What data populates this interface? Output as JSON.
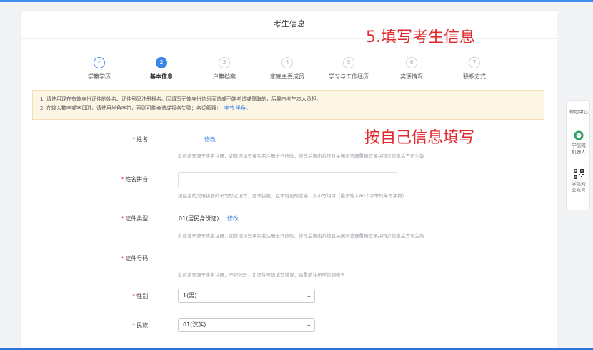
{
  "page": {
    "title": "考生信息"
  },
  "annotations": {
    "step_note": "5.填写考生信息",
    "fill_note": "按自己信息填写"
  },
  "steps": [
    {
      "num": "✓",
      "label": "学籍学历",
      "state": "done"
    },
    {
      "num": "2",
      "label": "基本信息",
      "state": "active"
    },
    {
      "num": "3",
      "label": "户籍档案",
      "state": "todo"
    },
    {
      "num": "4",
      "label": "家庭主要成员",
      "state": "todo"
    },
    {
      "num": "5",
      "label": "学习与工作经历",
      "state": "todo"
    },
    {
      "num": "6",
      "label": "奖惩情况",
      "state": "todo"
    },
    {
      "num": "7",
      "label": "联系方式",
      "state": "todo"
    }
  ],
  "notice": {
    "line1": "1. 请使用现在有效身份证件的姓名、证件号码注册报名。因填写无效身份信息而造成不能考试或录取的，后果由考生本人承担。",
    "line2": "2. 在输入数字或字母时，请使用半角字符，否则可能会造成报名失败；名词解释：",
    "link": "字节 半角。"
  },
  "form": {
    "required_mark": "*",
    "edit_label": "修改",
    "name": {
      "label": "姓名:",
      "hint": "此信息来源于实名注册，如有误请登录实名注册进行修改，修改后退出系统且关闭浏览器重新登录并同步信息后方可生效"
    },
    "pinyin": {
      "label": "姓名拼音:",
      "value": "",
      "hint": "按姓名的汉语拼音的书写形式填写，要求拼音，且不可出现空格、大小写均可（最多输入80个字节的半角字符）"
    },
    "id_type": {
      "label": "证件类型:",
      "value": "01(居民身份证)",
      "hint": "此信息来源于实名注册，如有误请登录实名注册进行修改，修改后退出系统且关闭浏览器重新登录并同步信息后方可生效"
    },
    "id_number": {
      "label": "证件号码:",
      "hint": "此信息来源于实名注册，不可修改，如证件号码填写错误，请重新注册学信网账号"
    },
    "gender": {
      "label": "性别:",
      "value": "1(男)"
    },
    "ethnicity": {
      "label": "民族:",
      "value": "01(汉族)"
    }
  },
  "sidebar": {
    "help": "帮助中心",
    "robot": "学信网机器人",
    "wechat": "学信网公众号"
  },
  "colors": {
    "accent": "#3a86e6",
    "annotation": "#e0282e",
    "required": "#e44444"
  }
}
